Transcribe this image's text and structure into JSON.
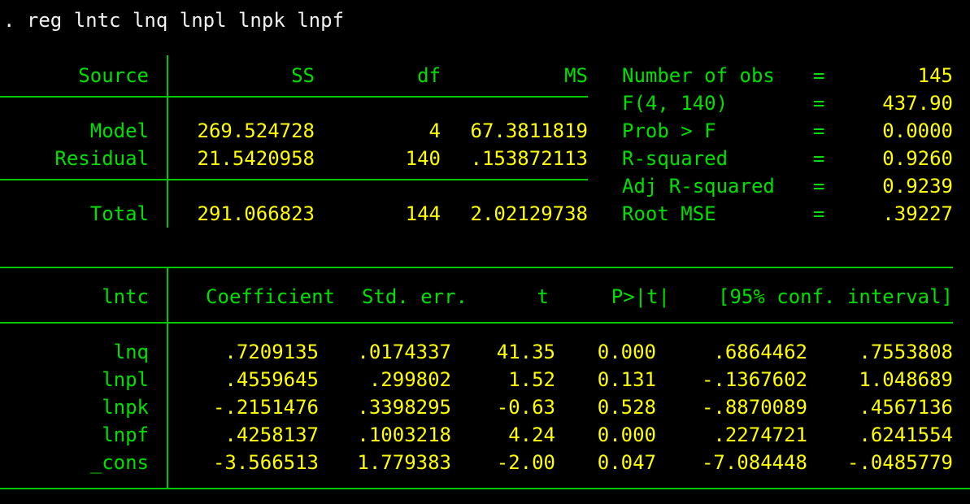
{
  "terminal": {
    "background_color": "#000000",
    "command_color": "#f2f2f2",
    "label_color": "#00e000",
    "value_color": "#ffff00",
    "rule_color": "#00c800"
  },
  "command_line": {
    "prompt": ".",
    "text": ". reg lntc lnq lnpl lnpk lnpf",
    "command": "reg",
    "depvar": "lntc",
    "indepvars": [
      "lnq",
      "lnpl",
      "lnpk",
      "lnpf"
    ]
  },
  "anova": {
    "headers": {
      "source": "Source",
      "ss": "SS",
      "df": "df",
      "ms": "MS"
    },
    "rows": [
      {
        "source": "Model",
        "ss": "269.524728",
        "df": "4",
        "ms": "67.3811819"
      },
      {
        "source": "Residual",
        "ss": "21.5420958",
        "df": "140",
        "ms": ".153872113"
      }
    ],
    "total": {
      "source": "Total",
      "ss": "291.066823",
      "df": "144",
      "ms": "2.02129738"
    }
  },
  "model_stats": [
    {
      "label": "Number of obs",
      "eq": "=",
      "value": "145"
    },
    {
      "label": "F(4, 140)",
      "eq": "=",
      "value": "437.90"
    },
    {
      "label": "Prob > F",
      "eq": "=",
      "value": "0.0000"
    },
    {
      "label": "R-squared",
      "eq": "=",
      "value": "0.9260"
    },
    {
      "label": "Adj R-squared",
      "eq": "=",
      "value": "0.9239"
    },
    {
      "label": "Root MSE",
      "eq": "=",
      "value": ".39227"
    }
  ],
  "coef_table": {
    "headers": {
      "depvar": "lntc",
      "coefficient": "Coefficient",
      "std_err": "Std. err.",
      "t": "t",
      "p": "P>|t|",
      "ci": "[95% conf. interval]"
    },
    "rows": [
      {
        "term": "lnq",
        "coef": ".7209135",
        "se": ".0174337",
        "t": "41.35",
        "p": "0.000",
        "ci_low": ".6864462",
        "ci_high": ".7553808"
      },
      {
        "term": "lnpl",
        "coef": ".4559645",
        "se": ".299802",
        "t": "1.52",
        "p": "0.131",
        "ci_low": "-.1367602",
        "ci_high": "1.048689"
      },
      {
        "term": "lnpk",
        "coef": "-.2151476",
        "se": ".3398295",
        "t": "-0.63",
        "p": "0.528",
        "ci_low": "-.8870089",
        "ci_high": ".4567136"
      },
      {
        "term": "lnpf",
        "coef": ".4258137",
        "se": ".1003218",
        "t": "4.24",
        "p": "0.000",
        "ci_low": ".2274721",
        "ci_high": ".6241554"
      },
      {
        "term": "_cons",
        "coef": "-3.566513",
        "se": "1.779383",
        "t": "-2.00",
        "p": "0.047",
        "ci_low": "-7.084448",
        "ci_high": "-.0485779"
      }
    ]
  }
}
